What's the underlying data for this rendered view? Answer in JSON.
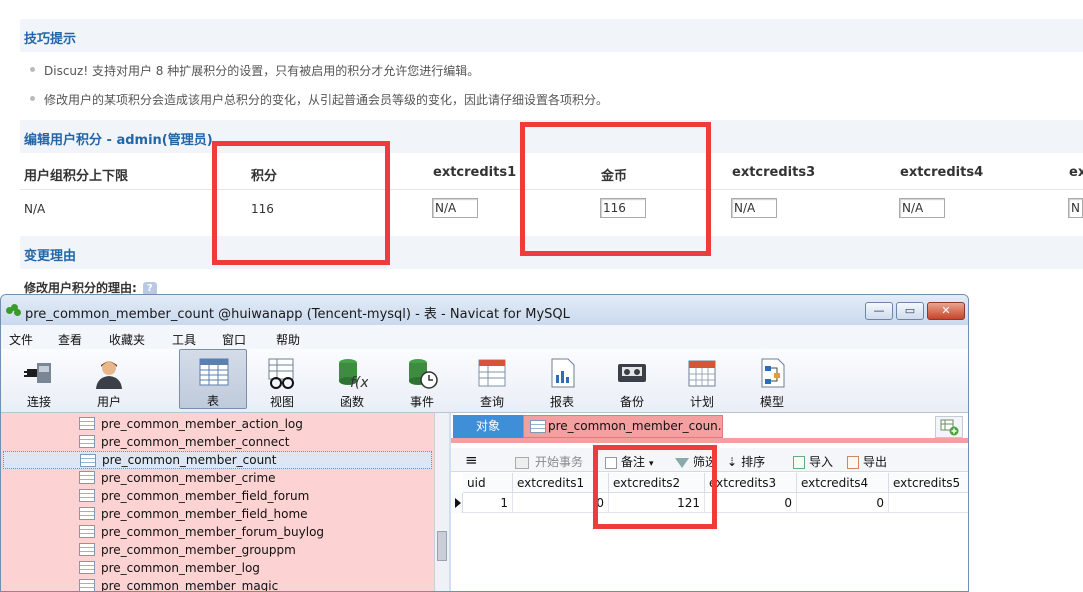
{
  "admin_page": {
    "tips_title": "技巧提示",
    "tips": [
      "Discuz! 支持对用户 8 种扩展积分的设置，只有被启用的积分才允许您进行编辑。",
      "修改用户的某项积分会造成该用户总积分的变化，从引起普通会员等级的变化，因此请仔细设置各项积分。"
    ],
    "edit_title": "编辑用户积分 - admin(管理员)",
    "columns": [
      "用户组积分上下限",
      "积分",
      "extcredits1",
      "金币",
      "extcredits3",
      "extcredits4",
      "ex"
    ],
    "row": {
      "range": "N/A",
      "credits": "116",
      "extcredits1": "N/A",
      "gold": "116",
      "extcredits3": "N/A",
      "extcredits4": "N/A",
      "extcredits5": "N/"
    },
    "reason_title": "变更理由",
    "reason_label": "修改用户积分的理由:",
    "help_icon": "?"
  },
  "navicat": {
    "title": "pre_common_member_count @huiwanapp (Tencent-mysql) - 表 - Navicat for MySQL",
    "window_buttons": [
      "—",
      "▭",
      "✕"
    ],
    "menu": [
      "文件",
      "查看",
      "收藏夹",
      "工具",
      "窗口",
      "帮助"
    ],
    "toolbar": [
      "连接",
      "用户",
      "表",
      "视图",
      "函数",
      "事件",
      "查询",
      "报表",
      "备份",
      "计划",
      "模型"
    ],
    "tree": [
      "pre_common_member_action_log",
      "pre_common_member_connect",
      "pre_common_member_count",
      "pre_common_member_crime",
      "pre_common_member_field_forum",
      "pre_common_member_field_home",
      "pre_common_member_forum_buylog",
      "pre_common_member_grouppm",
      "pre_common_member_log",
      "pre_common_member_magic"
    ],
    "tabs": {
      "objects": "对象",
      "table_tab": "pre_common_member_coun..."
    },
    "subtoolbar": {
      "menu_icon": "≡",
      "begin_tx": "开始事务",
      "note": "备注",
      "filter": "筛选",
      "sort": "排序",
      "import": "导入",
      "export": "导出"
    },
    "grid": {
      "headers": [
        "uid",
        "extcredits1",
        "extcredits2",
        "extcredits3",
        "extcredits4",
        "extcredits5"
      ],
      "row": [
        "1",
        "0",
        "121",
        "0",
        "0",
        ""
      ]
    }
  },
  "colors": {
    "highlight_red": "#ee3c3c",
    "section_blue": "#2366a8",
    "tree_pink": "#fdd2d2"
  }
}
